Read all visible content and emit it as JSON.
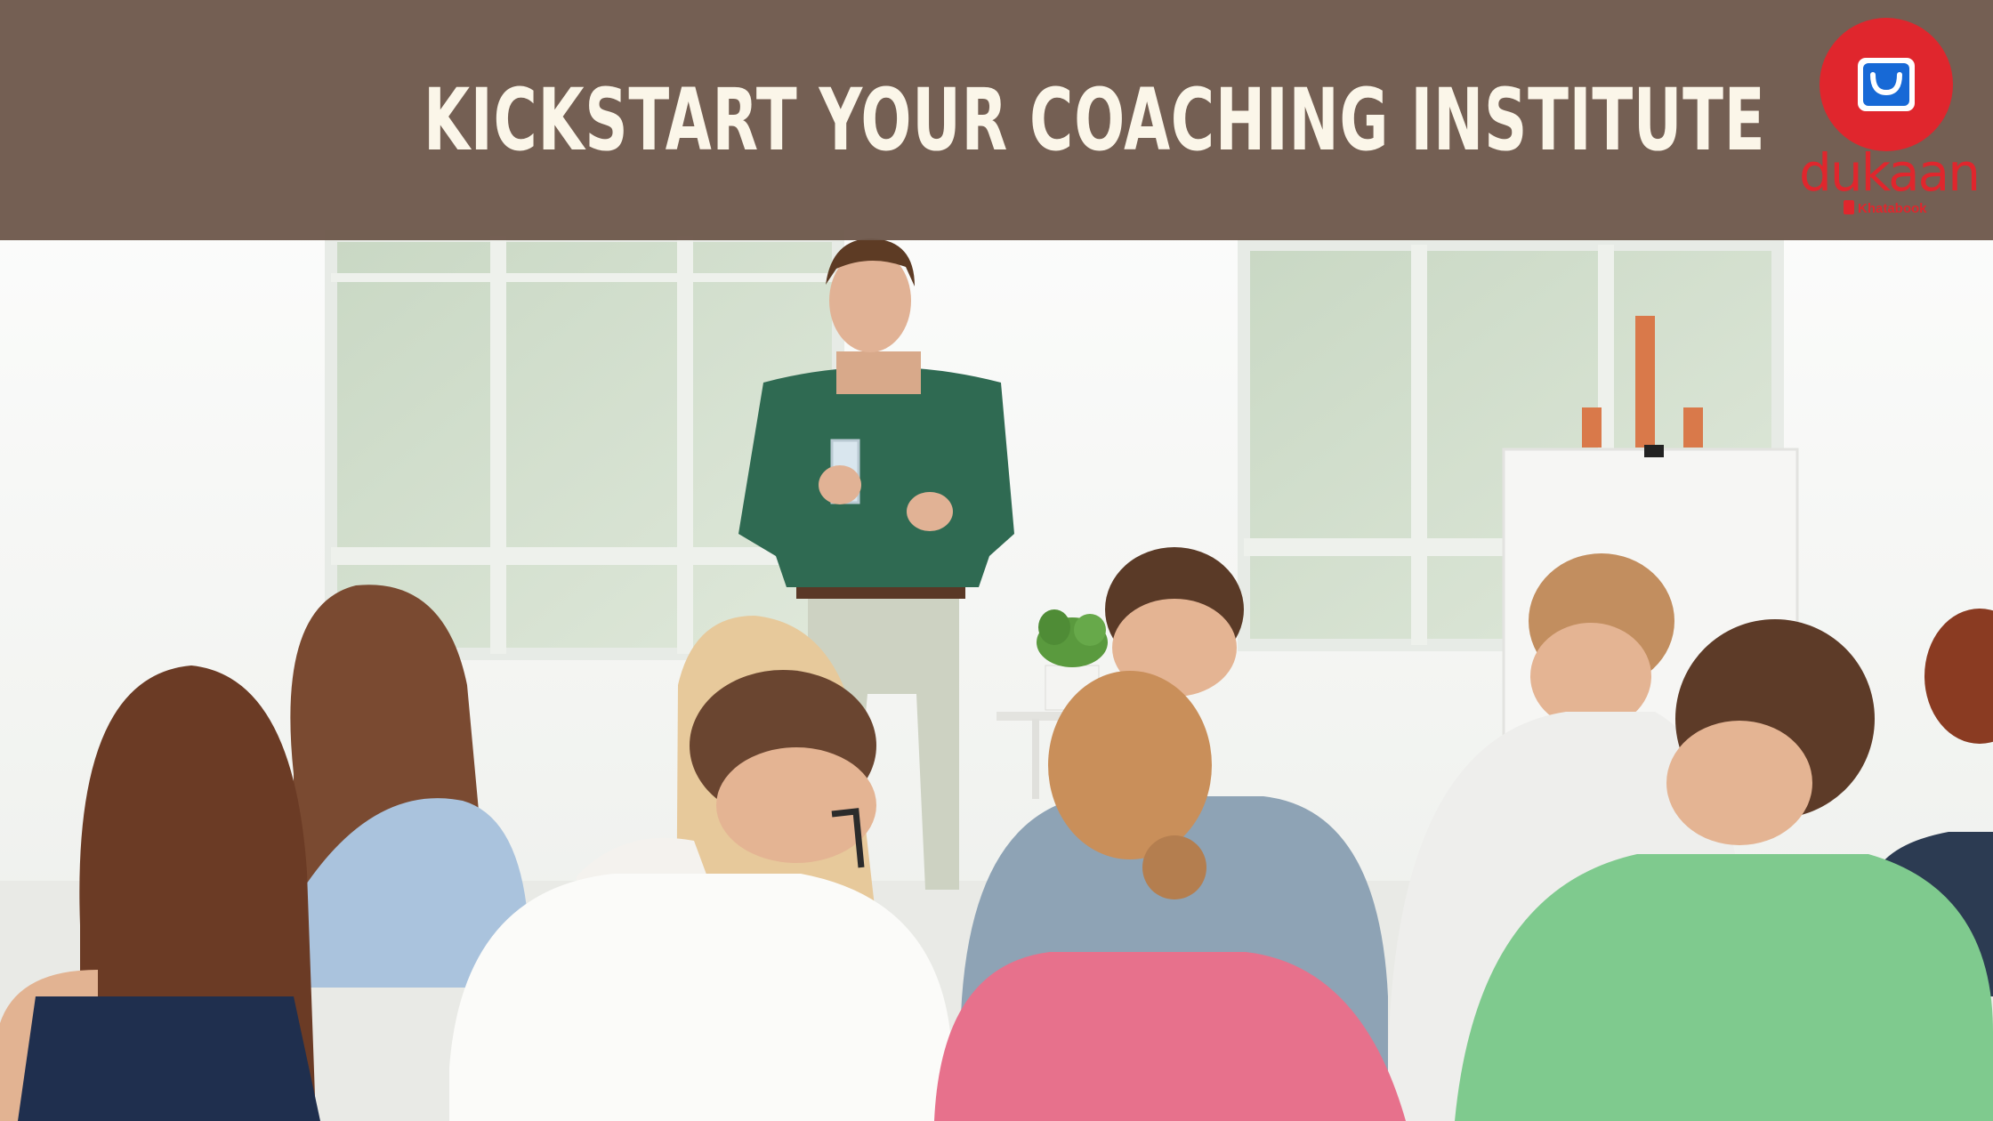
{
  "banner": {
    "title": "KICKSTART YOUR COACHING INSTITUTE"
  },
  "logo": {
    "word": "dukaan",
    "sub": "Khatabook",
    "icon": "shopping-bag-icon"
  },
  "colors": {
    "banner": "#6e584c",
    "banner_text": "#fbf6e9",
    "brand_red": "#e0262d",
    "brand_blue": "#1769d6"
  }
}
